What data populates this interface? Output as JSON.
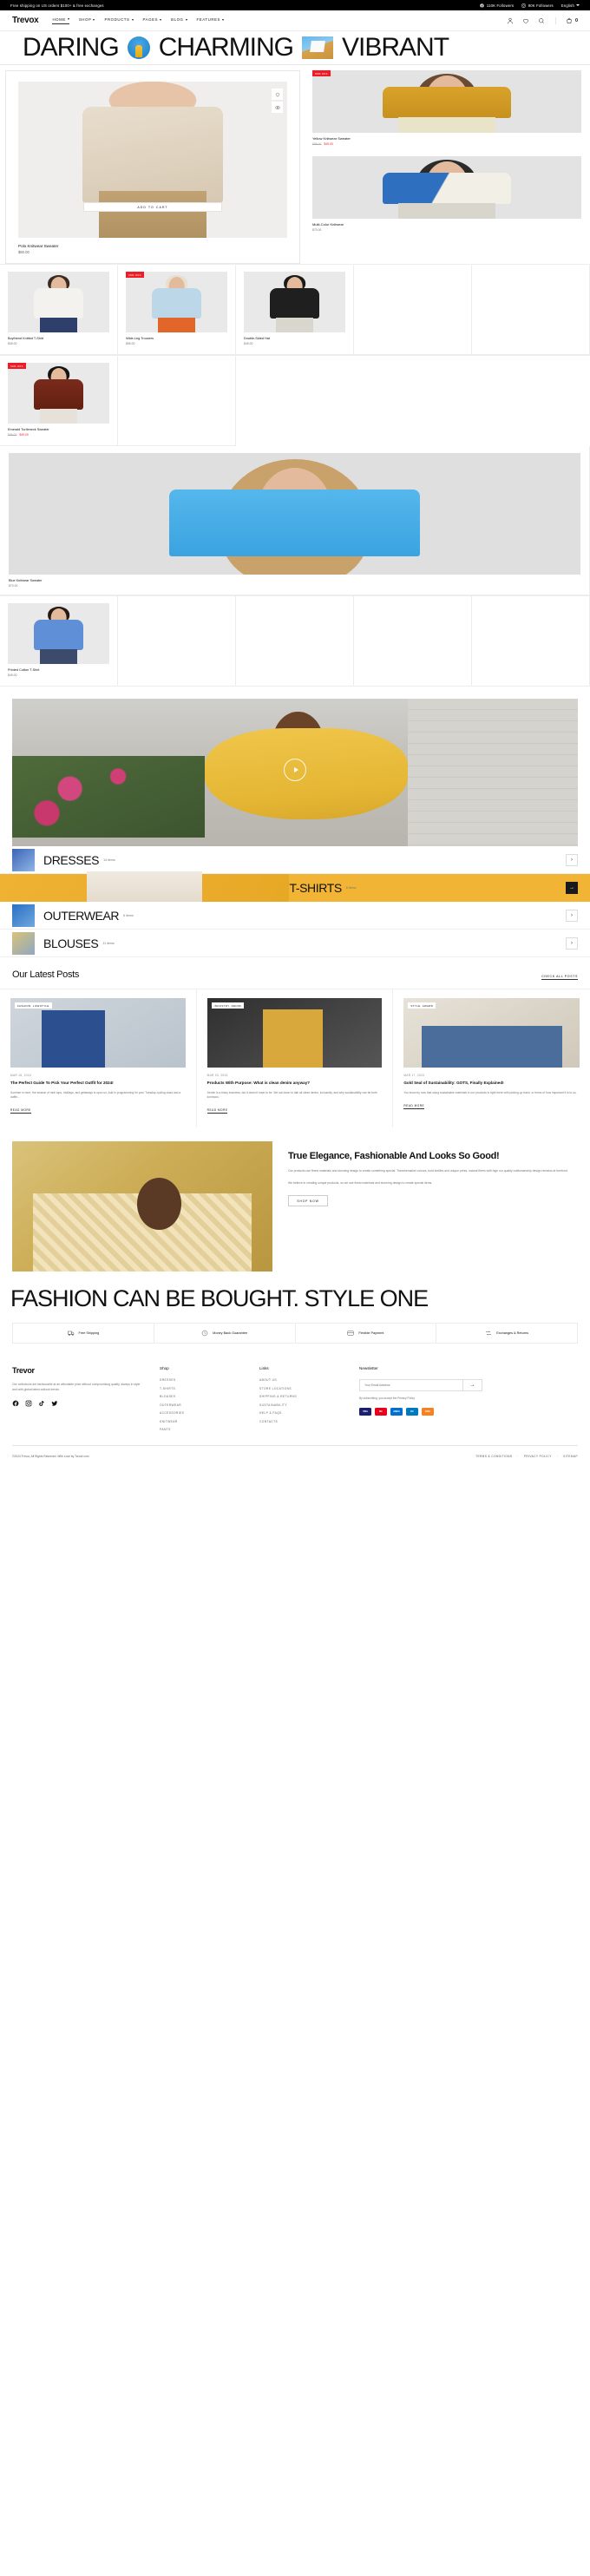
{
  "topbar": {
    "announcement": "Free shipping on US orders $100+ & free exchanges",
    "facebook_followers": "110K Followers",
    "instagram_followers": "90K Followers",
    "language": "English"
  },
  "header": {
    "logo": "Trevox",
    "nav": [
      {
        "label": "HOME",
        "active": true
      },
      {
        "label": "SHOP",
        "active": false
      },
      {
        "label": "PRODUCTS",
        "active": false
      },
      {
        "label": "PAGES",
        "active": false
      },
      {
        "label": "BLOG",
        "active": false
      },
      {
        "label": "FEATURES",
        "active": false
      }
    ],
    "cart_count": "0"
  },
  "marquee": {
    "word1": "DARING",
    "word2": "CHARMING",
    "word3": "VIBRANT"
  },
  "showcase": {
    "main": {
      "name": "Polo Knitwear Sweater",
      "price": "$60.00",
      "add_to_cart": "ADD TO CART"
    },
    "side": [
      {
        "name": "Yellow Knitwear Sweater",
        "badge": "50% OFF",
        "price_old": "$98.00",
        "price_new": "$49.00"
      },
      {
        "name": "Multi-Color Knitwear",
        "badge": "",
        "price": "$70.00"
      }
    ]
  },
  "grid": {
    "row1": [
      {
        "name": "Boyfriend Knitted T-Shirt",
        "badge": "",
        "price": "$35.00"
      },
      {
        "name": "Wide-Leg Trousers",
        "badge": "30% OFF",
        "price": "$55.00"
      },
      {
        "name": "Double-Sided Hat",
        "badge": "",
        "price": "$45.00"
      }
    ],
    "row2": [
      {
        "name": "Emerald Turtleneck Sweater",
        "badge": "50% OFF",
        "price_old": "$98.00",
        "price_new": "$49.00"
      },
      {
        "name": "Blue Knitwear Sweater",
        "badge": "",
        "price": "$70.00"
      }
    ],
    "row3": [
      {
        "name": "Printed Cotton T-Shirt",
        "badge": "",
        "price": "$49.00"
      }
    ]
  },
  "categories": [
    {
      "title": "DRESSES",
      "count": "14 items",
      "featured": false
    },
    {
      "title": "T-SHIRTS",
      "count": "8 items",
      "featured": true
    },
    {
      "title": "OUTERWEAR",
      "count": "6 items",
      "featured": false
    },
    {
      "title": "BLOUSES",
      "count": "11 items",
      "featured": false
    }
  ],
  "blog": {
    "title": "Our Latest Posts",
    "link": "CHECK ALL POSTS",
    "posts": [
      {
        "tag": "FASHION, LIFESTYLE",
        "date": "MAR 18, 2024",
        "title": "The Perfect Guide To Pick Your Perfect Outfit for 2024!",
        "excerpt": "Summer is here, the season of midi tops, midilays, and getaways is upon us. Add in programming for your Tuesday cycling class and a duffle...",
        "more": "READ MORE"
      },
      {
        "tag": "INDUSTRY, DENIM",
        "date": "MAR 03, 2024",
        "title": "Products With Purpose: What is clean denim anyway?",
        "excerpt": "Denim is a tricky business, but it doesn't have to be. We sat down to talk all clean denim, inclusivity, and why sustainability can be both luminous.",
        "more": "READ MORE"
      },
      {
        "tag": "STYLE, AWARD",
        "date": "MAR 17, 2024",
        "title": "Gold Seal of Sustainability: GOTS, Finally Explained!",
        "excerpt": "You know by now that using sustainable materials in our products is right there with picking up trash, or terms of how important it is to us.",
        "more": "READ MORE"
      }
    ]
  },
  "promo": {
    "title": "True Elegance, Fashionable And Looks So Good!",
    "paragraph1": "Our products use finest materials and stunning design to create something special. Transformative colours, bold textiles and unique prints, natural fibers with high our quality craftsmanship design remains at forefront.",
    "paragraph2": "We believe in creating unique products, so we use finest materials and stunning design to create special items.",
    "button": "SHOP NOW"
  },
  "bigtext": "FASHION CAN BE BOUGHT. STYLE ONE",
  "features": [
    {
      "label": "Free Shipping",
      "icon": "truck-icon"
    },
    {
      "label": "Money Back Guarantee",
      "icon": "refund-icon"
    },
    {
      "label": "Flexible Payment",
      "icon": "card-icon"
    },
    {
      "label": "Exchanges & Returns",
      "icon": "exchange-icon"
    }
  ],
  "footer": {
    "logo": "Trevor",
    "description": "Our collections are fashionable at an affordable price without compromising quality, always in style and with global latest outlook trends.",
    "shop": {
      "heading": "Shop",
      "items": [
        "DRESSES",
        "T-SHIRTS",
        "BLOUSES",
        "OUTERWEAR",
        "ACCESSORIES",
        "KNITWEAR",
        "PANTS"
      ]
    },
    "links": {
      "heading": "Links",
      "items": [
        "ABOUT US",
        "STORE LOCATIONS",
        "SHIPPING & RETURNS",
        "SUSTAINABILITY",
        "HELP & FAQS",
        "CONTACTS"
      ]
    },
    "newsletter": {
      "heading": "Newsletter",
      "placeholder": "Your Email Address",
      "note": "By subscribing, you accept the Privacy Policy",
      "payments": [
        "VISA",
        "MC",
        "AMEX",
        "DC",
        "DISC"
      ]
    },
    "copyright": "©2024 Trevor, All Rights Reserved. With Love by Toroof.com",
    "legal": [
      "TERMS & CONDITIONS",
      "PRIVACY POLICY",
      "SITEMAP"
    ]
  }
}
